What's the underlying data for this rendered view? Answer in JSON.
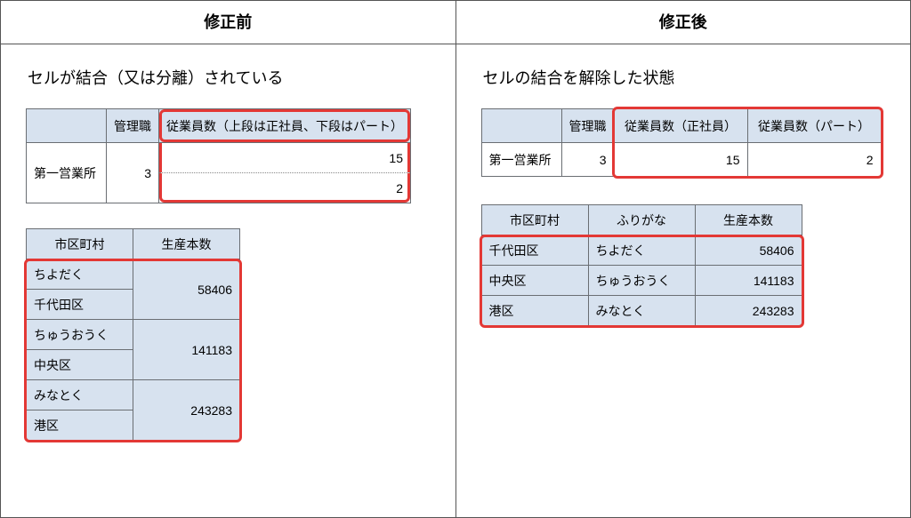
{
  "headers": {
    "before": "修正前",
    "after": "修正後"
  },
  "desc": {
    "before": "セルが結合（又は分離）されている",
    "after": "セルの結合を解除した状態"
  },
  "emp": {
    "before": {
      "cols": {
        "blank": "",
        "manager": "管理職",
        "employees": "従業員数（上段は正社員、下段はパート）"
      },
      "row": {
        "label": "第一営業所",
        "manager": "3",
        "upper": "15",
        "lower": "2"
      }
    },
    "after": {
      "cols": {
        "blank": "",
        "manager": "管理職",
        "emp_full": "従業員数（正社員）",
        "emp_part": "従業員数（パート）"
      },
      "row": {
        "label": "第一営業所",
        "manager": "3",
        "full": "15",
        "part": "2"
      }
    }
  },
  "prod": {
    "before": {
      "cols": {
        "ward": "市区町村",
        "qty": "生産本数"
      },
      "rows": [
        {
          "kana": "ちよだく",
          "ward": "千代田区",
          "qty": "58406"
        },
        {
          "kana": "ちゅうおうく",
          "ward": "中央区",
          "qty": "141183"
        },
        {
          "kana": "みなとく",
          "ward": "港区",
          "qty": "243283"
        }
      ]
    },
    "after": {
      "cols": {
        "ward": "市区町村",
        "kana": "ふりがな",
        "qty": "生産本数"
      },
      "rows": [
        {
          "ward": "千代田区",
          "kana": "ちよだく",
          "qty": "58406"
        },
        {
          "ward": "中央区",
          "kana": "ちゅうおうく",
          "qty": "141183"
        },
        {
          "ward": "港区",
          "kana": "みなとく",
          "qty": "243283"
        }
      ]
    }
  }
}
